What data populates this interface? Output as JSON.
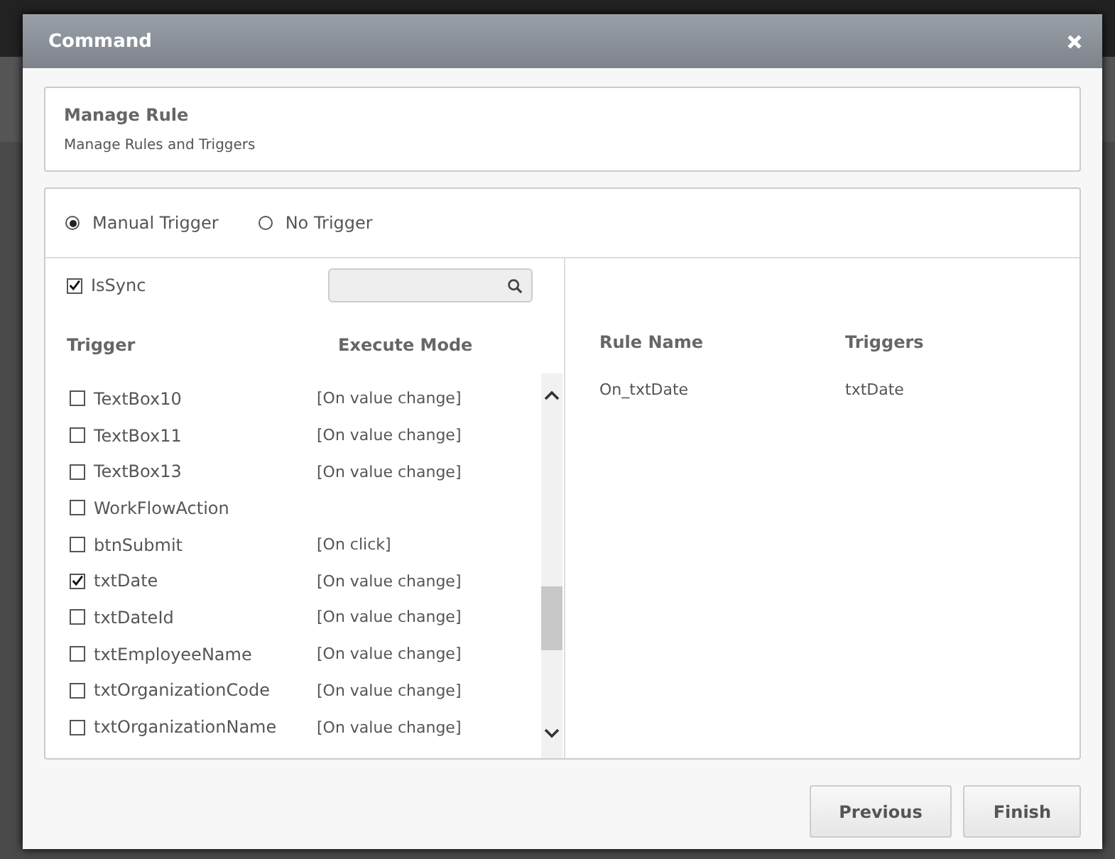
{
  "dialog": {
    "title": "Command"
  },
  "manage_rule": {
    "title": "Manage Rule",
    "subtitle": "Manage Rules and Triggers"
  },
  "trigger_options": [
    {
      "label": "Manual Trigger",
      "selected": true
    },
    {
      "label": "No Trigger",
      "selected": false
    }
  ],
  "is_sync": {
    "label": "IsSync",
    "checked": true
  },
  "trigger_table": {
    "columns": [
      "Trigger",
      "Execute Mode"
    ],
    "rows": [
      {
        "trigger": "TextBox10",
        "mode": "[On value change]",
        "checked": false
      },
      {
        "trigger": "TextBox11",
        "mode": "[On value change]",
        "checked": false
      },
      {
        "trigger": "TextBox13",
        "mode": "[On value change]",
        "checked": false
      },
      {
        "trigger": "WorkFlowAction",
        "mode": "",
        "checked": false
      },
      {
        "trigger": "btnSubmit",
        "mode": "[On click]",
        "checked": false
      },
      {
        "trigger": "txtDate",
        "mode": "[On value change]",
        "checked": true
      },
      {
        "trigger": "txtDateId",
        "mode": "[On value change]",
        "checked": false
      },
      {
        "trigger": "txtEmployeeName",
        "mode": "[On value change]",
        "checked": false
      },
      {
        "trigger": "txtOrganizationCode",
        "mode": "[On value change]",
        "checked": false
      },
      {
        "trigger": "txtOrganizationName",
        "mode": "[On value change]",
        "checked": false
      }
    ]
  },
  "rules_table": {
    "columns": [
      "Rule Name",
      "Triggers"
    ],
    "rows": [
      {
        "rule_name": "On_txtDate",
        "triggers": "txtDate"
      }
    ]
  },
  "buttons": [
    "Previous",
    "Finish"
  ]
}
